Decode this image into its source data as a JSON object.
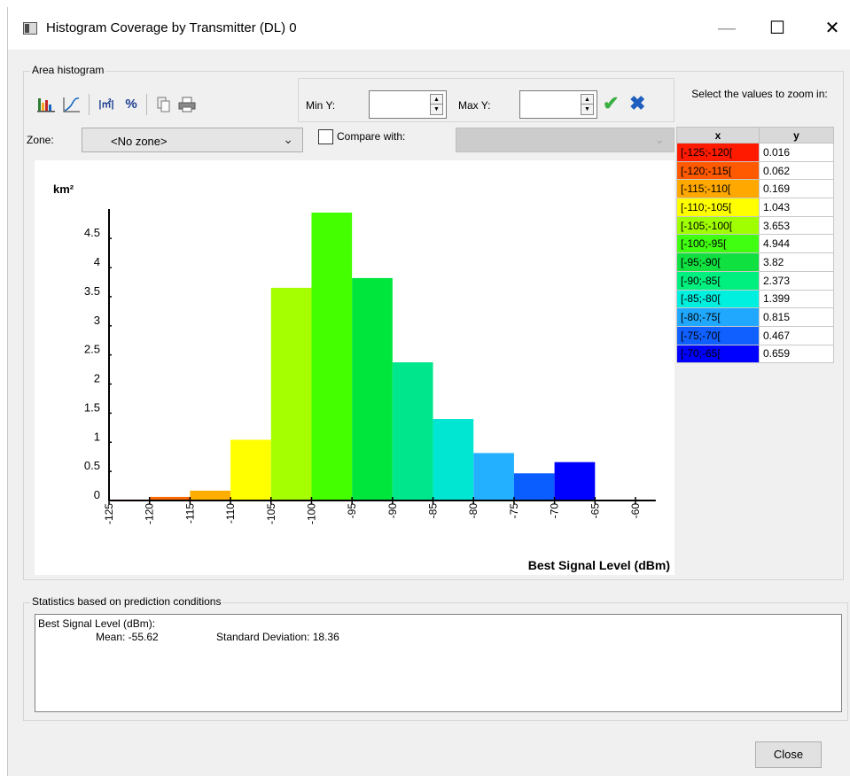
{
  "window": {
    "title": "Histogram  Coverage by Transmitter (DL) 0",
    "min_glyph": "—",
    "max_glyph": "☐",
    "close_glyph": "✕"
  },
  "area_group": {
    "label": "Area histogram"
  },
  "toolbar": {
    "icons": [
      "bar-chart-icon",
      "cumulative-curve-icon",
      "area-units-icon",
      "percent-icon",
      "copy-icon",
      "print-icon"
    ],
    "units_glyph": "|㎡|",
    "percent_glyph": "%"
  },
  "range": {
    "min_label": "Min Y:",
    "max_label": "Max Y:",
    "min_value": "",
    "max_value": "",
    "apply_glyph": "✔",
    "cancel_glyph": "✖",
    "apply_color": "#3cb043",
    "cancel_color": "#1f5fbf"
  },
  "zone": {
    "label": "Zone:",
    "value": "<No zone>"
  },
  "compare": {
    "label": "Compare with:",
    "checked": false,
    "value": ""
  },
  "chart_data": {
    "type": "bar",
    "ylabel": "km²",
    "xlabel": "Best Signal Level (dBm)",
    "y_ticks": [
      "0",
      "0.5",
      "1",
      "1.5",
      "2",
      "2.5",
      "3",
      "3.5",
      "4",
      "4.5"
    ],
    "x_ticks": [
      "-125",
      "-120",
      "-115",
      "-110",
      "-105",
      "-100",
      "-95",
      "-90",
      "-85",
      "-80",
      "-75",
      "-70",
      "-65",
      "-60"
    ],
    "xlim": [
      -125,
      -60
    ],
    "ylim": [
      0,
      4.944
    ],
    "categories": [
      "[-125;-120[",
      "[-120;-115[",
      "[-115;-110[",
      "[-110;-105[",
      "[-105;-100[",
      "[-100;-95[",
      "[-95;-90[",
      "[-90;-85[",
      "[-85;-80[",
      "[-80;-75[",
      "[-75;-70[",
      "[-70;-65["
    ],
    "values": [
      0.016,
      0.062,
      0.169,
      1.043,
      3.653,
      4.944,
      3.82,
      2.373,
      1.399,
      0.815,
      0.467,
      0.659
    ],
    "colors": [
      "#ff1a00",
      "#ff6a00",
      "#ffae00",
      "#ffff00",
      "#a6ff00",
      "#44ff00",
      "#00e63c",
      "#00e68c",
      "#00e6d2",
      "#22b0ff",
      "#0a5dff",
      "#0000ff"
    ]
  },
  "zoom_table": {
    "title": "Select the values to zoom in:",
    "col_x": "x",
    "col_y": "y",
    "rows": [
      {
        "x": "[-125;-120[",
        "y": "0.016",
        "color": "#ff1a00"
      },
      {
        "x": "[-120;-115[",
        "y": "0.062",
        "color": "#ff5a00"
      },
      {
        "x": "[-115;-110[",
        "y": "0.169",
        "color": "#ffa800"
      },
      {
        "x": "[-110;-105[",
        "y": "1.043",
        "color": "#ffff00"
      },
      {
        "x": "[-105;-100[",
        "y": "3.653",
        "color": "#a0ff00"
      },
      {
        "x": "[-100;-95[",
        "y": "4.944",
        "color": "#40ff10"
      },
      {
        "x": "[-95;-90[",
        "y": "3.82",
        "color": "#10e040"
      },
      {
        "x": "[-90;-85[",
        "y": "2.373",
        "color": "#00f080"
      },
      {
        "x": "[-85;-80[",
        "y": "1.399",
        "color": "#00f0e0"
      },
      {
        "x": "[-80;-75[",
        "y": "0.815",
        "color": "#20a8ff"
      },
      {
        "x": "[-75;-70[",
        "y": "0.467",
        "color": "#1060ff"
      },
      {
        "x": "[-70;-65[",
        "y": "0.659",
        "color": "#0000ff"
      }
    ]
  },
  "stats": {
    "group_label": "Statistics based on prediction conditions",
    "heading": "Best Signal Level (dBm):",
    "mean": "Mean: -55.62",
    "std": "Standard Deviation: 18.36"
  },
  "footer": {
    "close_label": "Close"
  }
}
